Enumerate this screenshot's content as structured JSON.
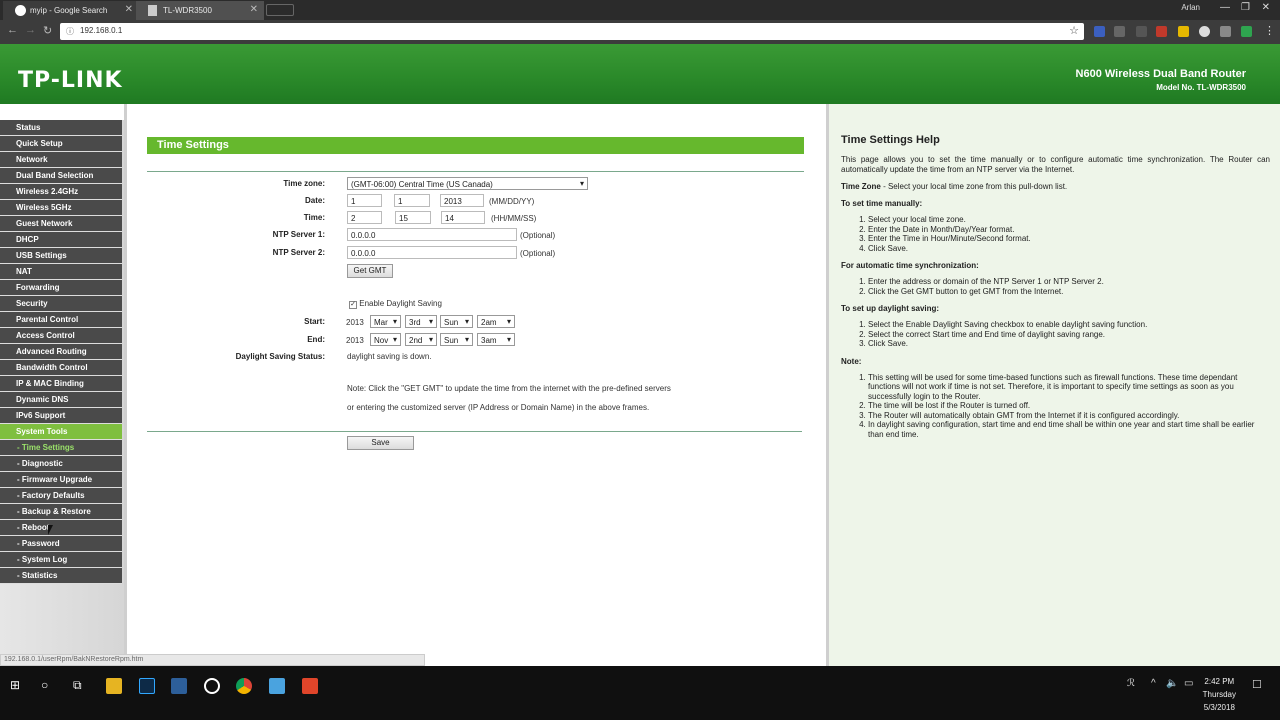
{
  "browser": {
    "tabs": [
      {
        "title": "myip - Google Search"
      },
      {
        "title": "TL-WDR3500"
      }
    ],
    "user": "Arlan",
    "url": "192.168.0.1"
  },
  "header": {
    "logo": "TP-LINK",
    "router_name": "N600 Wireless Dual Band Router",
    "model": "Model No. TL-WDR3500"
  },
  "sidebar": {
    "items": [
      {
        "label": "Status"
      },
      {
        "label": "Quick Setup"
      },
      {
        "label": "Network"
      },
      {
        "label": "Dual Band Selection"
      },
      {
        "label": "Wireless 2.4GHz"
      },
      {
        "label": "Wireless 5GHz"
      },
      {
        "label": "Guest Network"
      },
      {
        "label": "DHCP"
      },
      {
        "label": "USB Settings"
      },
      {
        "label": "NAT"
      },
      {
        "label": "Forwarding"
      },
      {
        "label": "Security"
      },
      {
        "label": "Parental Control"
      },
      {
        "label": "Access Control"
      },
      {
        "label": "Advanced Routing"
      },
      {
        "label": "Bandwidth Control"
      },
      {
        "label": "IP & MAC Binding"
      },
      {
        "label": "Dynamic DNS"
      },
      {
        "label": "IPv6 Support"
      },
      {
        "label": "System Tools"
      },
      {
        "label": "- Time Settings"
      },
      {
        "label": "- Diagnostic"
      },
      {
        "label": "- Firmware Upgrade"
      },
      {
        "label": "- Factory Defaults"
      },
      {
        "label": "- Backup & Restore"
      },
      {
        "label": "- Reboot"
      },
      {
        "label": "- Password"
      },
      {
        "label": "- System Log"
      },
      {
        "label": "- Statistics"
      }
    ]
  },
  "form": {
    "title": "Time Settings",
    "time_zone_label": "Time zone:",
    "time_zone_value": "(GMT-06:00) Central Time (US Canada)",
    "date_label": "Date:",
    "date_month": "1",
    "date_day": "1",
    "date_year": "2013",
    "date_format": "(MM/DD/YY)",
    "time_label": "Time:",
    "time_h": "2",
    "time_m": "15",
    "time_s": "14",
    "time_format": "(HH/MM/SS)",
    "ntp1_label": "NTP Server 1:",
    "ntp1_value": "0.0.0.0",
    "ntp2_label": "NTP Server 2:",
    "ntp2_value": "0.0.0.0",
    "optional": "(Optional)",
    "get_gmt": "Get GMT",
    "dst_checkbox": "Enable Daylight Saving",
    "start_label": "Start:",
    "start_year": "2013",
    "start_month": "Mar",
    "start_week": "3rd",
    "start_day": "Sun",
    "start_time": "2am",
    "end_label": "End:",
    "end_year": "2013",
    "end_month": "Nov",
    "end_week": "2nd",
    "end_day": "Sun",
    "end_time": "3am",
    "dst_status_label": "Daylight Saving Status:",
    "dst_status_value": "daylight saving is down.",
    "note1": "Note: Click the \"GET GMT\" to update the time from the internet with the pre-defined servers",
    "note2": "or entering the customized server (IP Address or Domain Name) in the above frames.",
    "save": "Save"
  },
  "help": {
    "title": "Time Settings Help",
    "intro": "This page allows you to set the time manually or to configure automatic time synchronization. The Router can automatically update the time from an NTP server via the Internet.",
    "tz_term": "Time Zone",
    "tz_text": " - Select your local time zone from this pull-down list.",
    "manual_title": "To set time manually:",
    "manual_steps": [
      "Select your local time zone.",
      "Enter the Date in Month/Day/Year format.",
      "Enter the Time in Hour/Minute/Second format.",
      "Click Save."
    ],
    "auto_title": "For automatic time synchronization:",
    "auto_steps": [
      "Enter the address or domain of the NTP Server 1 or NTP Server 2.",
      "Click the Get GMT button to get GMT from the Internet."
    ],
    "dst_title": "To set up daylight saving:",
    "dst_steps": [
      "Select the Enable Daylight Saving checkbox to enable daylight saving function.",
      "Select the correct Start time and End time of daylight saving range.",
      "Click Save."
    ],
    "note_title": "Note:",
    "note_steps": [
      "This setting will be used for some time-based functions such as firewall functions. These time dependant functions will not work if time is not set. Therefore, it is important to specify time settings as soon as you successfully login to the Router.",
      "The time will be lost if the Router is turned off.",
      "The Router will automatically obtain GMT from the Internet if it is configured accordingly.",
      "In daylight saving configuration, start time and end time shall be within one year and start time shall be earlier than end time."
    ]
  },
  "statusbar": {
    "url": "192.168.0.1/userRpm/BakNRestoreRpm.htm"
  },
  "taskbar": {
    "time": "2:42 PM",
    "day": "Thursday",
    "date": "5/3/2018"
  }
}
